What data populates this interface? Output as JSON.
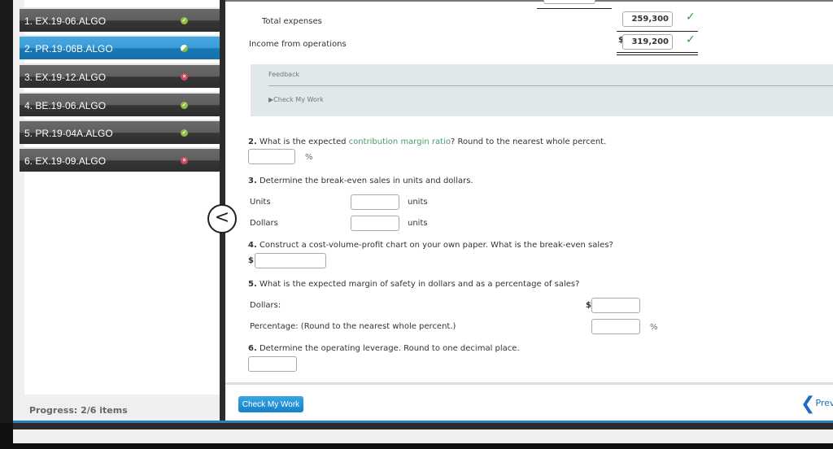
{
  "sidebar": {
    "items": [
      {
        "label": "1. EX.19-06.ALGO",
        "status": "correct"
      },
      {
        "label": "2. PR.19-06B.ALGO",
        "status": "partial",
        "active": true
      },
      {
        "label": "3. EX.19-12.ALGO",
        "status": "incorrect"
      },
      {
        "label": "4. BE.19-06.ALGO",
        "status": "correct"
      },
      {
        "label": "5. PR.19-04A.ALGO",
        "status": "correct"
      },
      {
        "label": "6. EX.19-09.ALGO",
        "status": "incorrect"
      }
    ],
    "progress": "Progress:  2/6 items"
  },
  "statement": {
    "total_expenses_label": "Total expenses",
    "total_expenses_value": "259,300",
    "income_label": "Income from operations",
    "income_currency": "$",
    "income_value": "319,200"
  },
  "feedback": {
    "title": "Feedback",
    "toggle": "Check My Work"
  },
  "questions": {
    "q2": {
      "num": "2.",
      "pre": "What is the expected ",
      "link": "contribution margin ratio",
      "post": "? Round to the nearest whole percent.",
      "unit": "%"
    },
    "q3": {
      "num": "3.",
      "text": "Determine the break-even sales in units and dollars.",
      "units_label": "Units",
      "units_unit": "units",
      "dollars_label": "Dollars",
      "dollars_unit": "units"
    },
    "q4": {
      "num": "4.",
      "text": "Construct a cost-volume-profit chart on your own paper. What is the break-even sales?",
      "currency": "$"
    },
    "q5": {
      "num": "5.",
      "text": "What is the expected margin of safety in dollars and as a percentage of sales?",
      "dollars_label": "Dollars:",
      "currency": "$",
      "pct_label": "Percentage: (Round to the nearest whole percent.)",
      "unit": "%"
    },
    "q6": {
      "num": "6.",
      "text": "Determine the operating leverage. Round to one decimal place."
    }
  },
  "footer": {
    "check_label": "Check My Work",
    "prev_label": "Previous"
  },
  "colors": {
    "accent": "#1a8ad4",
    "correct": "#3a9a3a",
    "link": "#4a9a6a"
  }
}
